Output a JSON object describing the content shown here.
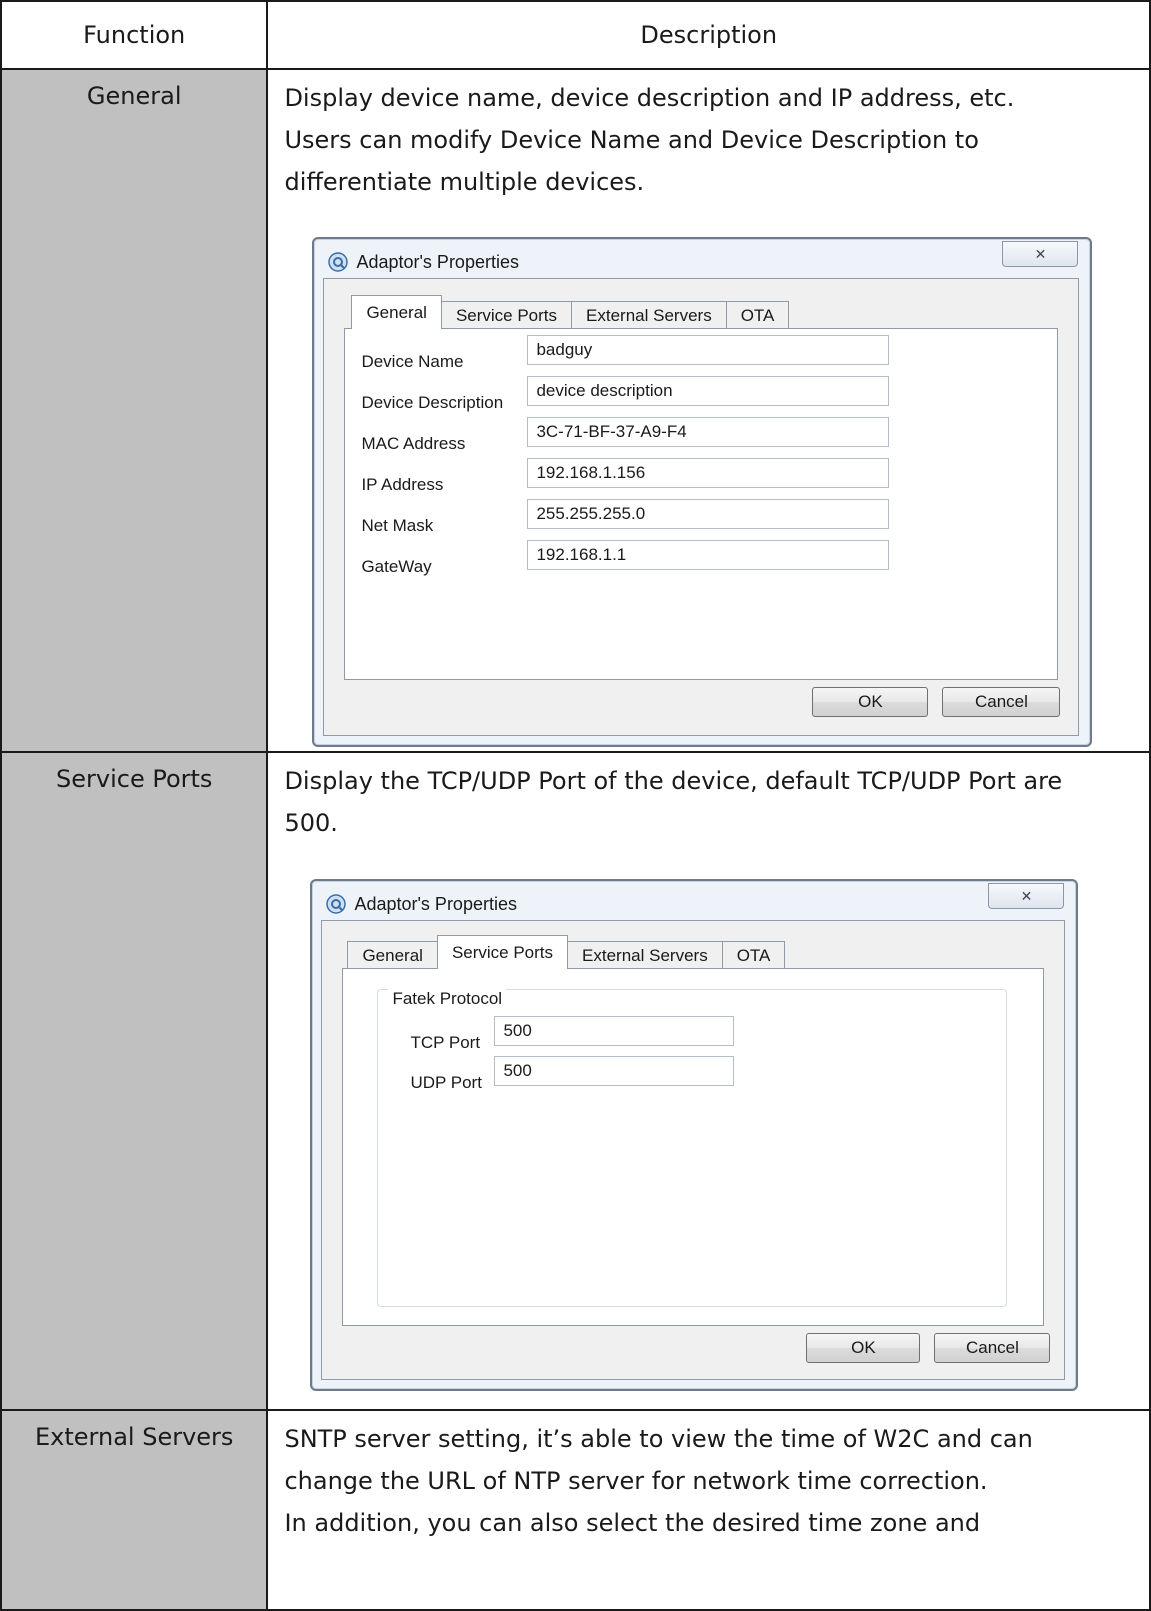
{
  "table": {
    "headers": {
      "function": "Function",
      "description": "Description"
    },
    "rows": [
      {
        "function": "General",
        "description": "Display device name, device description and IP address, etc.\nUsers can modify Device Name and Device Description to\ndifferentiate multiple devices."
      },
      {
        "function": "Service Ports",
        "description": "Display the TCP/UDP Port of the device, default TCP/UDP Port are\n500."
      },
      {
        "function": "External Servers",
        "description": "SNTP server setting, it’s able to view the time of W2C and can\nchange the URL of NTP server for network time correction.\nIn addition, you can also select the desired time zone and"
      }
    ]
  },
  "dialog_general": {
    "title": "Adaptor's Properties",
    "close_glyph": "✕",
    "tabs": [
      "General",
      "Service Ports",
      "External Servers",
      "OTA"
    ],
    "active_tab": "General",
    "fields": [
      {
        "label": "Device Name",
        "value": "badguy"
      },
      {
        "label": "Device Description",
        "value": "device description"
      },
      {
        "label": "MAC Address",
        "value": "3C-71-BF-37-A9-F4"
      },
      {
        "label": "IP Address",
        "value": "192.168.1.156"
      },
      {
        "label": "Net Mask",
        "value": "255.255.255.0"
      },
      {
        "label": "GateWay",
        "value": "192.168.1.1"
      }
    ],
    "ok_label": "OK",
    "cancel_label": "Cancel"
  },
  "dialog_ports": {
    "title": "Adaptor's Properties",
    "close_glyph": "✕",
    "tabs": [
      "General",
      "Service Ports",
      "External Servers",
      "OTA"
    ],
    "active_tab": "Service Ports",
    "group_title": "Fatek Protocol",
    "fields": [
      {
        "label": "TCP Port",
        "value": "500"
      },
      {
        "label": "UDP Port",
        "value": "500"
      }
    ],
    "ok_label": "OK",
    "cancel_label": "Cancel"
  },
  "colors": {
    "function_cell_bg": "#c0c0c0",
    "border": "#1a1a1a",
    "dialog_frame": "#eef3f9"
  }
}
